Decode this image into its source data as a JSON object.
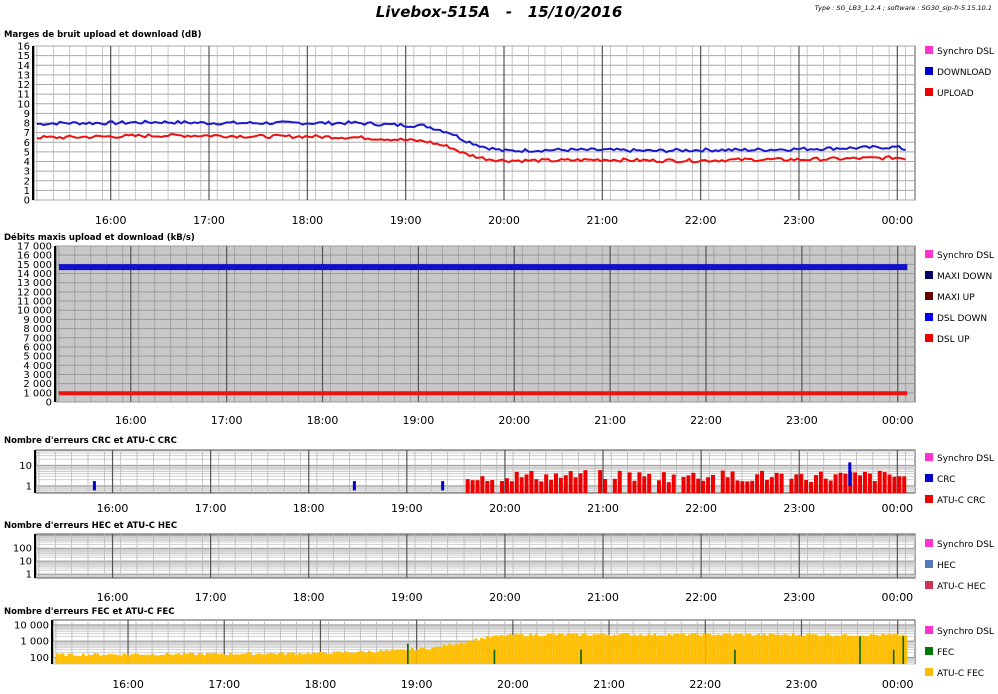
{
  "title": "Livebox-515A   -   15/10/2016",
  "meta": "Type : SG_LB3_1.2.4 ; software : SG30_sip-fr-5.15.10.1",
  "chart_data": [
    {
      "id": "noise",
      "type": "line",
      "title": "Marges de bruit upload et download (dB)",
      "ylim": [
        0,
        16
      ],
      "yticks": [
        "0",
        "1",
        "2",
        "3",
        "4",
        "5",
        "6",
        "7",
        "8",
        "9",
        "10",
        "11",
        "12",
        "13",
        "14",
        "15",
        "16"
      ],
      "xlim": [
        15.22,
        24.18
      ],
      "x_ticks": [
        "16:00",
        "17:00",
        "18:00",
        "19:00",
        "20:00",
        "21:00",
        "22:00",
        "23:00",
        "00:00"
      ],
      "grid": true,
      "legend": [
        "Synchro DSL",
        "DOWNLOAD",
        "UPLOAD"
      ],
      "legend_colors": [
        "#ff33cc",
        "#0000cc",
        "#ee0000"
      ],
      "legend_position": "right",
      "series": [
        {
          "name": "DOWNLOAD",
          "color": "#1a1acc",
          "x": [
            15.25,
            15.5,
            16.0,
            16.5,
            17.0,
            17.5,
            18.0,
            18.5,
            18.9,
            19.2,
            19.45,
            19.6,
            19.8,
            20.0,
            20.5,
            21.0,
            21.5,
            22.0,
            22.5,
            23.0,
            23.5,
            24.0,
            24.1
          ],
          "y": [
            7.9,
            8.0,
            8.0,
            8.1,
            8.0,
            8.0,
            8.0,
            8.0,
            7.8,
            7.7,
            7.0,
            6.2,
            5.5,
            5.1,
            5.2,
            5.2,
            5.1,
            5.2,
            5.2,
            5.3,
            5.4,
            5.5,
            5.2
          ]
        },
        {
          "name": "UPLOAD",
          "color": "#ee1111",
          "x": [
            15.25,
            15.5,
            16.0,
            16.5,
            17.0,
            17.5,
            18.0,
            18.5,
            18.9,
            19.2,
            19.45,
            19.6,
            19.8,
            20.0,
            20.5,
            21.0,
            21.5,
            22.0,
            22.5,
            23.0,
            23.5,
            24.0,
            24.1
          ],
          "y": [
            6.5,
            6.5,
            6.6,
            6.7,
            6.7,
            6.6,
            6.6,
            6.5,
            6.3,
            6.1,
            5.5,
            4.8,
            4.3,
            4.1,
            4.1,
            4.2,
            4.1,
            4.1,
            4.2,
            4.2,
            4.3,
            4.4,
            4.3
          ]
        }
      ]
    },
    {
      "id": "rates",
      "type": "line",
      "title": "Débits maxis upload et download (kB/s)",
      "ylim": [
        0,
        17000
      ],
      "yticks": [
        "0",
        "1 000",
        "2 000",
        "3 000",
        "4 000",
        "5 000",
        "6 000",
        "7 000",
        "8 000",
        "9 000",
        "10 000",
        "11 000",
        "12 000",
        "13 000",
        "14 000",
        "15 000",
        "16 000",
        "17 000"
      ],
      "xlim": [
        15.22,
        24.18
      ],
      "x_ticks": [
        "16:00",
        "17:00",
        "18:00",
        "19:00",
        "20:00",
        "21:00",
        "22:00",
        "23:00",
        "00:00"
      ],
      "grid": true,
      "legend": [
        "Synchro DSL",
        "MAXI DOWN",
        "MAXI UP",
        "DSL DOWN",
        "DSL UP"
      ],
      "legend_colors": [
        "#ff33cc",
        "#000066",
        "#660000",
        "#0000ee",
        "#ee0000"
      ],
      "legend_position": "right",
      "series": [
        {
          "name": "DSL DOWN",
          "color": "#1111cc",
          "x": [
            15.25,
            24.1
          ],
          "y": [
            14700,
            14700
          ]
        },
        {
          "name": "DSL UP",
          "color": "#ee1111",
          "x": [
            15.25,
            24.1
          ],
          "y": [
            950,
            950
          ]
        }
      ]
    },
    {
      "id": "crc",
      "type": "bar",
      "title": "Nombre d'erreurs CRC et ATU-C CRC",
      "yscale": "log",
      "yticks": [
        "1",
        "10"
      ],
      "xlim": [
        15.22,
        24.18
      ],
      "x_ticks": [
        "16:00",
        "17:00",
        "18:00",
        "19:00",
        "20:00",
        "21:00",
        "22:00",
        "23:00",
        "00:00"
      ],
      "grid": true,
      "legend": [
        "Synchro DSL",
        "CRC",
        "ATU-C CRC"
      ],
      "legend_colors": [
        "#ff33cc",
        "#0000cc",
        "#ee0000"
      ],
      "legend_position": "right",
      "series": [
        {
          "name": "CRC",
          "color": "#0000cc",
          "x": [
            15.8,
            18.45,
            19.35,
            23.5
          ],
          "y": [
            1,
            1,
            1,
            14
          ]
        },
        {
          "name": "ATU-C CRC",
          "color": "#ee0000",
          "x_range": [
            19.6,
            24.1
          ],
          "y_range": [
            1,
            6
          ]
        }
      ]
    },
    {
      "id": "hec",
      "type": "bar",
      "title": "Nombre d'erreurs HEC et ATU-C HEC",
      "yscale": "log",
      "yticks": [
        "1",
        "10",
        "100"
      ],
      "xlim": [
        15.22,
        24.18
      ],
      "x_ticks": [
        "16:00",
        "17:00",
        "18:00",
        "19:00",
        "20:00",
        "21:00",
        "22:00",
        "23:00",
        "00:00"
      ],
      "grid": true,
      "legend": [
        "Synchro DSL",
        "HEC",
        "ATU-C HEC"
      ],
      "legend_colors": [
        "#ff33cc",
        "#5577bb",
        "#cc3355"
      ],
      "legend_position": "right",
      "series": []
    },
    {
      "id": "fec",
      "type": "bar",
      "title": "Nombre d'erreurs FEC et ATU-C FEC",
      "yscale": "log",
      "yticks": [
        "100",
        "1 000",
        "10 000"
      ],
      "xlim": [
        15.22,
        24.18
      ],
      "x_ticks": [
        "16:00",
        "17:00",
        "18:00",
        "19:00",
        "20:00",
        "21:00",
        "22:00",
        "23:00",
        "00:00"
      ],
      "grid": true,
      "legend": [
        "Synchro DSL",
        "FEC",
        "ATU-C FEC"
      ],
      "legend_colors": [
        "#ff33cc",
        "#007700",
        "#ffbb00"
      ],
      "legend_position": "right",
      "series": [
        {
          "name": "ATU-C FEC",
          "color": "#ffbf00",
          "x": [
            15.25,
            16.0,
            17.0,
            18.0,
            18.8,
            19.2,
            19.5,
            19.8,
            20.0,
            21.0,
            22.0,
            23.0,
            24.0,
            24.1
          ],
          "y": [
            150,
            160,
            170,
            190,
            260,
            420,
            900,
            2000,
            2500,
            2600,
            2600,
            2500,
            2400,
            2300
          ]
        },
        {
          "name": "FEC",
          "color": "#006600",
          "x": [
            18.9,
            19.8,
            20.7,
            22.3,
            23.6,
            23.95,
            24.05
          ],
          "y": [
            700,
            300,
            300,
            300,
            2000,
            300,
            2000
          ]
        }
      ]
    }
  ]
}
